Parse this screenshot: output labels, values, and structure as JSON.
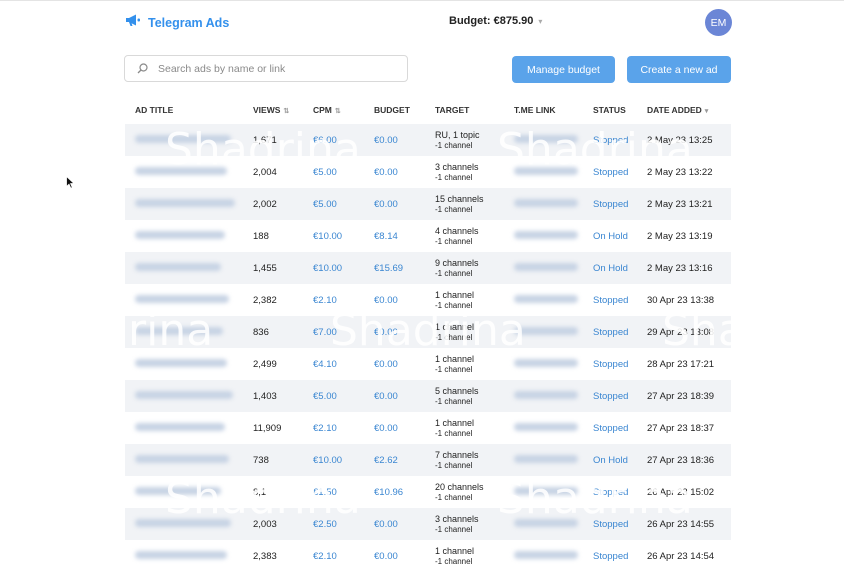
{
  "header": {
    "app_name": "Telegram Ads",
    "budget": "Budget: €875.90",
    "avatar_initials": "EM"
  },
  "toolbar": {
    "search_placeholder": "Search ads by name or link",
    "manage_budget": "Manage budget",
    "create_ad": "Create a new ad"
  },
  "table": {
    "headers": [
      "AD TITLE",
      "VIEWS",
      "CPM",
      "BUDGET",
      "TARGET",
      "T.ME LINK",
      "STATUS",
      "DATE ADDED"
    ],
    "rows": [
      {
        "views": "1,671",
        "cpm": "€6.00",
        "budget": "€0.00",
        "target": "RU, 1 topic",
        "target_sub": "-1 channel",
        "status": "Stopped",
        "date": "2 May 23 13:25"
      },
      {
        "views": "2,004",
        "cpm": "€5.00",
        "budget": "€0.00",
        "target": "3 channels",
        "target_sub": "-1 channel",
        "status": "Stopped",
        "date": "2 May 23 13:22"
      },
      {
        "views": "2,002",
        "cpm": "€5.00",
        "budget": "€0.00",
        "target": "15 channels",
        "target_sub": "-1 channel",
        "status": "Stopped",
        "date": "2 May 23 13:21"
      },
      {
        "views": "188",
        "cpm": "€10.00",
        "budget": "€8.14",
        "target": "4 channels",
        "target_sub": "-1 channel",
        "status": "On Hold",
        "date": "2 May 23 13:19"
      },
      {
        "views": "1,455",
        "cpm": "€10.00",
        "budget": "€15.69",
        "target": "9 channels",
        "target_sub": "-1 channel",
        "status": "On Hold",
        "date": "2 May 23 13:16"
      },
      {
        "views": "2,382",
        "cpm": "€2.10",
        "budget": "€0.00",
        "target": "1 channel",
        "target_sub": "-1 channel",
        "status": "Stopped",
        "date": "30 Apr 23 13:38"
      },
      {
        "views": "836",
        "cpm": "€7.00",
        "budget": "€0.00",
        "target": "1 channel",
        "target_sub": "-1 channel",
        "status": "Stopped",
        "date": "29 Apr 23 13:08"
      },
      {
        "views": "2,499",
        "cpm": "€4.10",
        "budget": "€0.00",
        "target": "1 channel",
        "target_sub": "-1 channel",
        "status": "Stopped",
        "date": "28 Apr 23 17:21"
      },
      {
        "views": "1,403",
        "cpm": "€5.00",
        "budget": "€0.00",
        "target": "5 channels",
        "target_sub": "-1 channel",
        "status": "Stopped",
        "date": "27 Apr 23 18:39"
      },
      {
        "views": "11,909",
        "cpm": "€2.10",
        "budget": "€0.00",
        "target": "1 channel",
        "target_sub": "-1 channel",
        "status": "Stopped",
        "date": "27 Apr 23 18:37"
      },
      {
        "views": "738",
        "cpm": "€10.00",
        "budget": "€2.62",
        "target": "7 channels",
        "target_sub": "-1 channel",
        "status": "On Hold",
        "date": "27 Apr 23 18:36"
      },
      {
        "views": "8,1",
        "cpm": "€1.50",
        "budget": "€10.96",
        "target": "20 channels",
        "target_sub": "-1 channel",
        "status": "Stopped",
        "date": "26 Apr 23 15:02"
      },
      {
        "views": "2,003",
        "cpm": "€2.50",
        "budget": "€0.00",
        "target": "3 channels",
        "target_sub": "-1 channel",
        "status": "Stopped",
        "date": "26 Apr 23 14:55"
      },
      {
        "views": "2,383",
        "cpm": "€2.10",
        "budget": "€0.00",
        "target": "1 channel",
        "target_sub": "-1 channel",
        "status": "Stopped",
        "date": "26 Apr 23 14:54"
      }
    ]
  },
  "watermark": {
    "text_full": "Shadrina",
    "text_partial": "rina"
  },
  "colors": {
    "accent": "#3390ec",
    "button": "#5aa3ea",
    "link_blue": "#3a86d1",
    "row_stripe": "#f1f3f6"
  }
}
